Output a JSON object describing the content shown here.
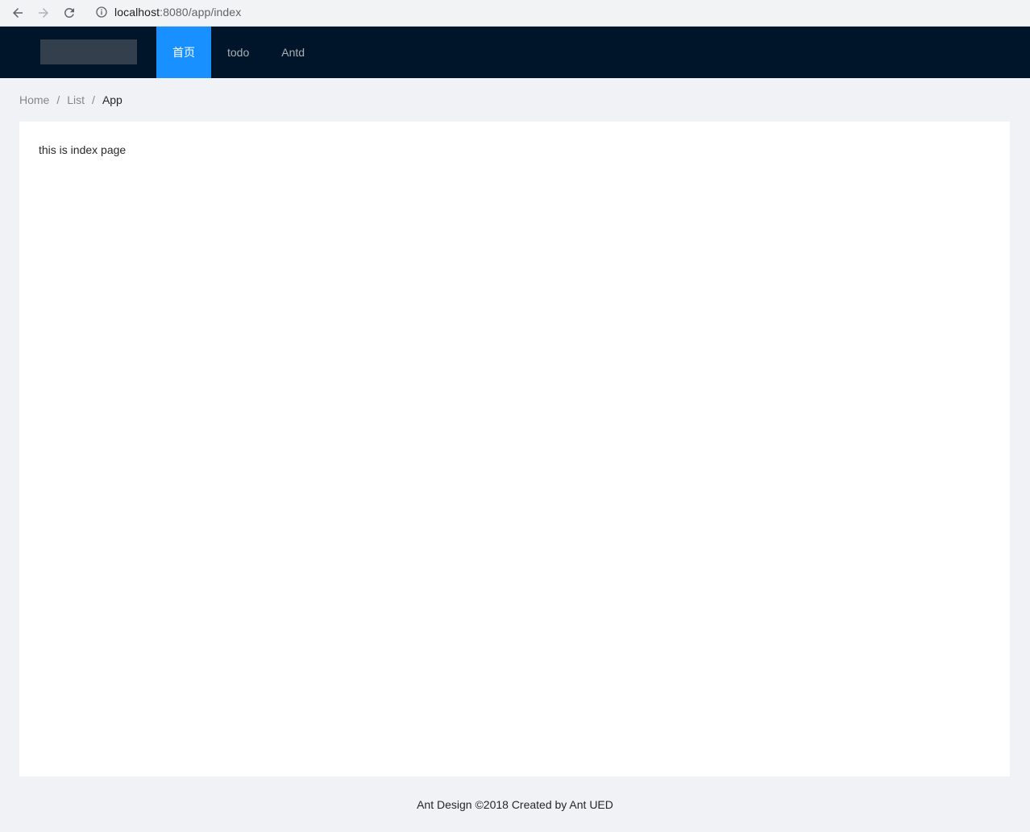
{
  "browser": {
    "url_host": "localhost",
    "url_path": ":8080/app/index",
    "back_icon": "arrow-left-icon",
    "forward_icon": "arrow-right-icon",
    "reload_icon": "reload-icon",
    "info_icon": "info-icon"
  },
  "header": {
    "menu": [
      {
        "label": "首页",
        "active": true
      },
      {
        "label": "todo",
        "active": false
      },
      {
        "label": "Antd",
        "active": false
      }
    ],
    "colors": {
      "background": "#001529",
      "active": "#1890ff",
      "logo": "#333f4d"
    }
  },
  "breadcrumb": [
    "Home",
    "List",
    "App"
  ],
  "content": {
    "text": "this is index page"
  },
  "footer": {
    "text": "Ant Design ©2018 Created by Ant UED"
  }
}
